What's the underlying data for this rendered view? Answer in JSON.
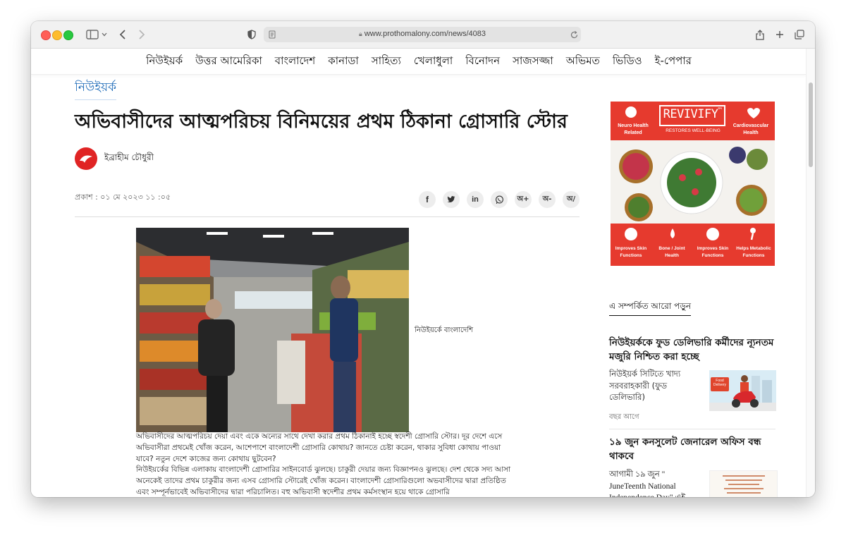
{
  "browser": {
    "url": "www.prothomalony.com/news/4083"
  },
  "nav": {
    "items": [
      "নিউইয়র্ক",
      "উত্তর আমেরিকা",
      "বাংলাদেশ",
      "কানাডা",
      "সাহিত্য",
      "খেলাধুলা",
      "বিনোদন",
      "সাজসজ্জা",
      "অভিমত",
      "ভিডিও",
      "ই-পেপার"
    ]
  },
  "article": {
    "section": "নিউইয়র্ক",
    "headline": "অভিবাসীদের আত্মপরিচয় বিনিময়ের প্রথম ঠিকানা গ্রোসারি স্টোর",
    "author": "ইব্রাহীম চৌধুরী",
    "published": "প্রকাশ : ০১ মে ২০২৩ ১১ :০৫",
    "share": {
      "font_plus": "অ+",
      "font_minus": "অ-",
      "font_reset": "অ/"
    },
    "photo_caption": "নিউইয়র্কে বাংলাদেশি",
    "paragraphs": [
      "অভিবাসীদের আত্মপরিচয় দেয়া এবং একে অন্যের সাথে দেখা করার প্রথম ঠিকানাই হচ্ছে স্বদেশী গ্রোসারি স্টোর। দূর দেশে এসে অভিবাসীরা প্রথমেই খোঁজ করেন, আশেপাশে বাংলাদেশী গ্রোসারি কোথায়? জানতে চেষ্টা করেন, থাকার সুবিধা কোথায় পাওয়া যাবে? নতুন দেশে কাজের জন্য কোথায় ছুটবেন?",
      "নিউইয়র্কের বিভিন্ন এলাকায় বাংলাদেশী গ্রোসারির সাইনবোর্ড ঝুলছে। চাকুরী দেয়ার জন্য বিজ্ঞাপনও ঝুলছে। দেশ থেকে সদ্য আসা অনেকেই তাদের প্রথম চাকুরীর জন্য এসব গ্রোসারি স্টোরেই খোঁজ করেন। বাংলাদেশী গ্রোসারিগুলো অভবাসীদের দ্বারা প্রতিষ্ঠিত এবং সম্পূর্নভাবেই অভিবাসীদের দ্বারা পরিচালিত। বহু অভিবাসী স্বদেশীর প্রথম কর্মসংস্থান হয়ে থাকে গ্রোসারি"
    ]
  },
  "ad": {
    "brand": "REVIVIFY",
    "tm": "™",
    "tagline": "RESTORES WELL-BEING",
    "top_left": "Neuro Health Related",
    "top_right": "Cardiovascular Health",
    "features": [
      "Improves Skin Functions",
      "Bone / Joint Health",
      "Improves Skin Functions",
      "Helps Metabolic Functions"
    ],
    "food_badge": "Food Delivery"
  },
  "related": {
    "heading": "এ সম্পর্কিত আরো পড়ুন",
    "items": [
      {
        "title": "নিউইয়র্ককে ফুড ডেলিভারি কর্মীদের ন্যূনতম মজুরি নিশ্চিত করা হচ্ছে",
        "summary": "নিউইয়র্ক সিটিতে খাদ্য সরবরাহকারী (ফুড ডেলিভারি)",
        "time": "বছর আগে"
      },
      {
        "title": "১৯ জুন কনসুলেট জেনারেল অফিস বন্ধ থাকবে",
        "summary": "আগামী ১৯ জুন \" JuneTeenth National Independence Day\" এই"
      }
    ]
  }
}
